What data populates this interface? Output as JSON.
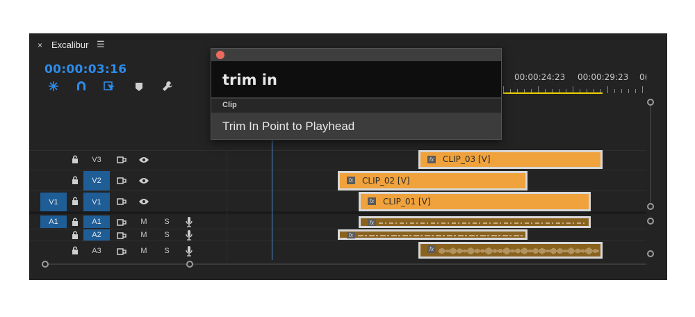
{
  "panel": {
    "close_glyph": "×",
    "sequence_name": "Excalibur",
    "menu_glyph": "☰",
    "timecode": "00:00:03:16",
    "ruler_labels": [
      "00:00:24:23",
      "00:00:29:23",
      "0("
    ]
  },
  "tools": [
    {
      "icon": "nest-icon"
    },
    {
      "icon": "snap-magnet-icon"
    },
    {
      "icon": "linked-selection-icon"
    },
    {
      "icon": "add-marker-icon"
    },
    {
      "icon": "wrench-settings-icon"
    }
  ],
  "tracks": {
    "video": [
      {
        "source": "",
        "label": "V3",
        "targeted": false
      },
      {
        "source": "",
        "label": "V2",
        "targeted": true
      },
      {
        "source": "V1",
        "label": "V1",
        "targeted": true
      }
    ],
    "audio": [
      {
        "source": "A1",
        "label": "A1",
        "targeted": true,
        "mute": "M",
        "solo": "S"
      },
      {
        "source": "",
        "label": "A2",
        "targeted": true,
        "mute": "M",
        "solo": "S"
      },
      {
        "source": "",
        "label": "A3",
        "targeted": false,
        "mute": "M",
        "solo": "S"
      }
    ]
  },
  "clips": {
    "fx_glyph": "fx",
    "video": [
      "CLIP_03 [V]",
      "CLIP_02 [V]",
      "CLIP_01 [V]"
    ]
  },
  "dialog": {
    "query": "trim in",
    "section": "Clip",
    "result": "Trim In Point to Playhead"
  },
  "colors": {
    "timecode": "#2d8ceb",
    "video_clip": "#f0a33c",
    "audio_clip": "#8a6220",
    "track_target": "#1f5d97",
    "work_area": "#f0d000",
    "playhead": "#4a90d9",
    "dialog_close": "#ed6a5e"
  }
}
